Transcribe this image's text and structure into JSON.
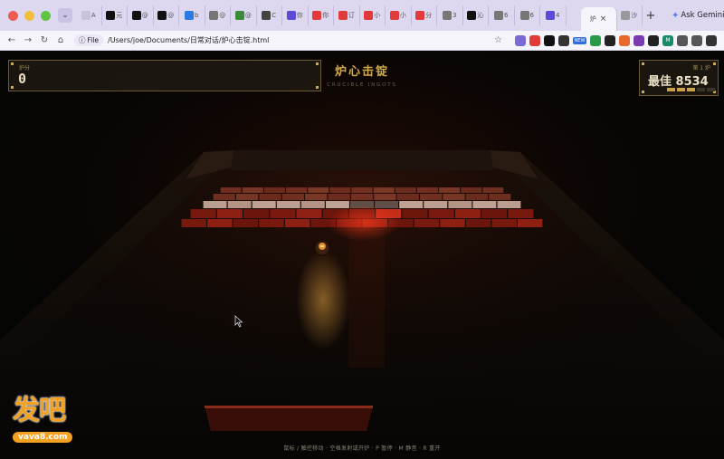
{
  "browser": {
    "tab_dropdown": "⌄",
    "tabs": [
      {
        "icon": "page-icon",
        "text": "A",
        "color": "#c9c2dc"
      },
      {
        "icon": "x-icon",
        "text": "元",
        "color": "#111111"
      },
      {
        "icon": "threads-icon",
        "text": "@",
        "color": "#111111"
      },
      {
        "icon": "threads-icon",
        "text": "@",
        "color": "#111111"
      },
      {
        "icon": "bird-icon",
        "text": "b",
        "color": "#2a7ae2"
      },
      {
        "icon": "gear-icon",
        "text": "@",
        "color": "#777777"
      },
      {
        "icon": "image-icon",
        "text": "@",
        "color": "#3a8a3a"
      },
      {
        "icon": "heart-icon",
        "text": "C",
        "color": "#444444"
      },
      {
        "icon": "wave-icon",
        "text": "你",
        "color": "#5a4ad6"
      },
      {
        "icon": "red-icon",
        "text": "你",
        "color": "#e23a3a"
      },
      {
        "icon": "red-icon",
        "text": "订",
        "color": "#e23a3a"
      },
      {
        "icon": "red-icon",
        "text": "小",
        "color": "#e23a3a"
      },
      {
        "icon": "red-icon",
        "text": "小",
        "color": "#e23a3a"
      },
      {
        "icon": "red-icon",
        "text": "分",
        "color": "#e23a3a"
      },
      {
        "icon": "globe-icon",
        "text": "3",
        "color": "#777777"
      },
      {
        "icon": "x-icon",
        "text": "沁",
        "color": "#111111"
      },
      {
        "icon": "globe-icon",
        "text": "6",
        "color": "#777777"
      },
      {
        "icon": "globe-icon",
        "text": "6",
        "color": "#777777"
      },
      {
        "icon": "purple-icon",
        "text": "4",
        "color": "#5a4ad6"
      }
    ],
    "active_tab": {
      "text": "炉",
      "close": "×"
    },
    "trailing_tab": {
      "text": "沙"
    },
    "new_tab": "+",
    "ask_gemini": "Ask Gemini",
    "file_chip": "File",
    "url": "/Users/joe/Documents/日常对话/炉心击锭.html",
    "extensions": [
      {
        "name": "shield-ext-icon",
        "color": "#7b6ad6"
      },
      {
        "name": "red-ext-icon",
        "color": "#e23a3a"
      },
      {
        "name": "play-ext-icon",
        "color": "#111111"
      },
      {
        "name": "store-ext-icon",
        "color": "#333333"
      },
      {
        "name": "new-ext-badge",
        "color": "#2f6ce0",
        "text": "NEW"
      },
      {
        "name": "green-ext-icon",
        "color": "#2a9a4a"
      },
      {
        "name": "chat-ext-icon",
        "color": "#222222"
      },
      {
        "name": "orange-ext-icon",
        "color": "#e86a2a"
      },
      {
        "name": "purple-ext-icon",
        "color": "#7a3ab0"
      },
      {
        "name": "dark-ext-icon",
        "color": "#222222"
      },
      {
        "name": "m-ext-icon",
        "color": "#1a8a6a",
        "text": "M"
      },
      {
        "name": "puzzle-ext-icon",
        "color": "#555555"
      },
      {
        "name": "sidebar-ext-icon",
        "color": "#555555"
      },
      {
        "name": "avatar-ext-icon",
        "color": "#333333"
      }
    ]
  },
  "game": {
    "score_label": "炉分",
    "score": "0",
    "title": "炉心击锭",
    "subtitle": "CRUCIBLE INGOTS",
    "level": "第 1 炉",
    "best": "最佳 8534",
    "lives_total": 5,
    "lives_remaining": 3,
    "controls_hint": "鼠标 / 触控移动 · 空格发射或开炉 · P 暂停 · M 静音 · R 重开",
    "colors": {
      "gold": "#cfa84a",
      "brick_hot": "#c8321e",
      "brick_warm": "#e06040",
      "floor": "#0c0a07"
    },
    "bricks": [
      {
        "row": 0,
        "pattern": "warm"
      },
      {
        "row": 1,
        "pattern": "pale"
      },
      {
        "row": 2,
        "pattern": "hot"
      },
      {
        "row": 3,
        "pattern": "hot"
      }
    ]
  },
  "watermark": {
    "big": "发吧",
    "small": "vava8.com"
  }
}
